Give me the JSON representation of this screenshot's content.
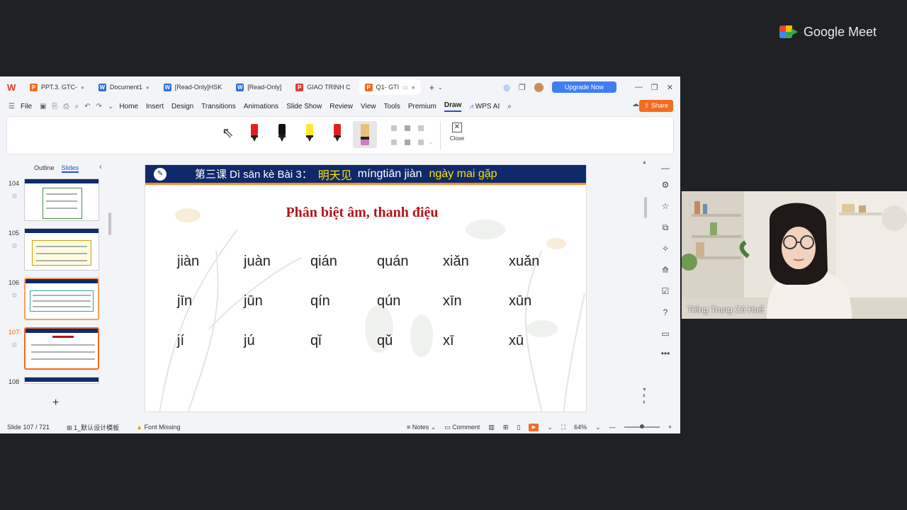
{
  "meet": {
    "brand": "Google Meet",
    "participant_name": "Tiếng Trung Cô Huế"
  },
  "tabs": [
    {
      "label": "PPT.3. GTC-",
      "type": "p",
      "icon_letter": "P"
    },
    {
      "label": "Document1",
      "type": "w",
      "icon_letter": "W"
    },
    {
      "label": "[Read-Only]HSK",
      "type": "w",
      "icon_letter": "W"
    },
    {
      "label": "[Read-Only]",
      "type": "w",
      "icon_letter": "W"
    },
    {
      "label": "GIAO TRINH C",
      "type": "pdf",
      "icon_letter": "P"
    },
    {
      "label": "Q1- GTI",
      "type": "p",
      "icon_letter": "P"
    }
  ],
  "toolbar": {
    "upgrade_label": "Upgrade Now",
    "file_label": "File",
    "share_label": "Share",
    "wps_ai_label": "WPS AI",
    "menu": [
      "Home",
      "Insert",
      "Design",
      "Transitions",
      "Animations",
      "Slide Show",
      "Review",
      "View",
      "Tools",
      "Premium"
    ],
    "active_menu": "Draw"
  },
  "ribbon": {
    "close_label": "Close"
  },
  "panel": {
    "outline_label": "Outline",
    "slides_label": "Slides",
    "thumbs": [
      {
        "num": "104"
      },
      {
        "num": "105"
      },
      {
        "num": "106"
      },
      {
        "num": "107"
      },
      {
        "num": "108"
      }
    ]
  },
  "slide": {
    "header_cn": "第三课",
    "header_vi": "Dì sān kè Bài 3：",
    "header_cn2": "明天见",
    "header_py": "míngtiān  jiàn",
    "header_vi2": "ngày mai gặp",
    "title": "Phân biệt âm, thanh điệu",
    "rows": [
      [
        "jiàn",
        "juàn",
        "qián",
        "quán",
        "xiǎn",
        "xuǎn"
      ],
      [
        "jīn",
        "jūn",
        "qín",
        "qún",
        "xīn",
        "xūn"
      ],
      [
        "jí",
        "jú",
        "qǐ",
        "qǔ",
        "xī",
        "xū"
      ]
    ]
  },
  "status": {
    "slide_counter": "Slide 107 / 721",
    "template": "1_默认设计模板",
    "font_missing": "Font Missing",
    "notes_label": "Notes",
    "comment_label": "Comment",
    "zoom": "64%"
  },
  "colors": {
    "accent": "#f26b21",
    "header_blue": "#0f2a6b",
    "title_red": "#b2161d",
    "highlight_yellow": "#ffe100"
  }
}
